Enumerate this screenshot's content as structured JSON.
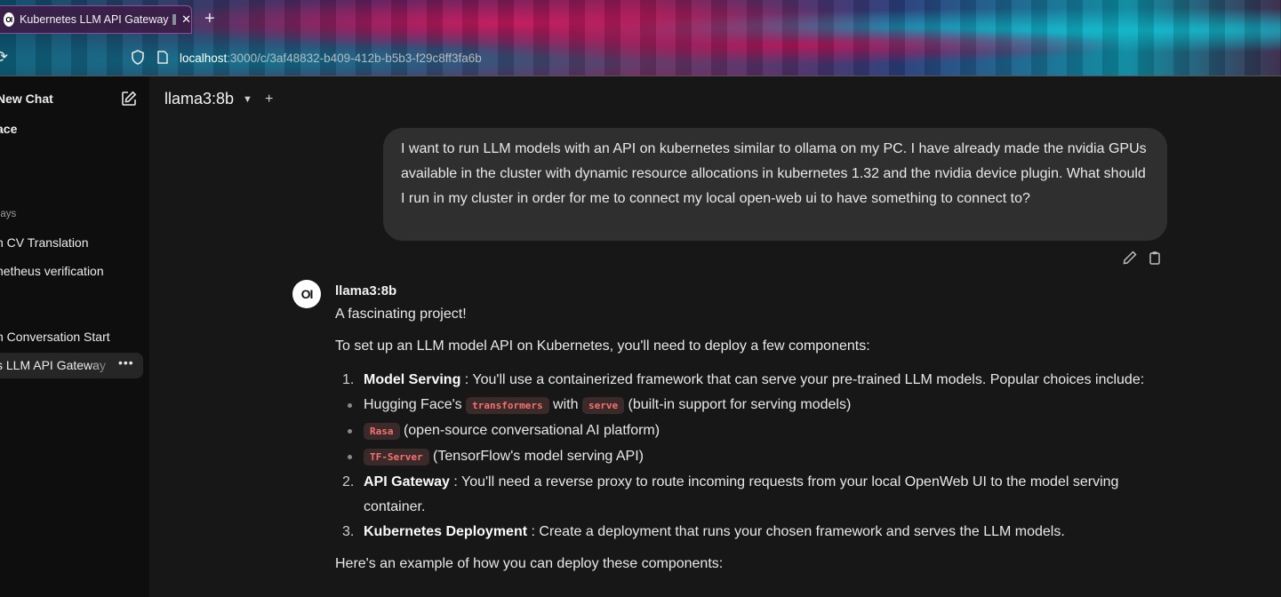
{
  "browser": {
    "tab_title": "Kubernetes LLM API Gateway",
    "tab_close": "✕",
    "new_tab": "+",
    "url_host": "localhost",
    "url_path": ":3000/c/3af48832-b409-412b-b5b3-f29c8ff3fa6b",
    "favicon_text": "OI"
  },
  "sidebar": {
    "new_chat": "New Chat",
    "workspace": "ace",
    "section_label": "days",
    "chats": [
      "h CV Translation",
      "netheus verification",
      "h Conversation Start"
    ],
    "active_chat": "s LLM API Gateway",
    "more": "•••"
  },
  "header": {
    "model": "llama3:8b",
    "chevron": "⌄",
    "add": "+"
  },
  "user_message": "I want to run LLM models with an API on kubernetes similar to ollama on my PC. I have already made the nvidia GPUs available in the cluster with dynamic resource allocations in kubernetes 1.32 and the nvidia device plugin. What should I run in my cluster in order for me to connect my local open-web ui to have something to connect to?",
  "assistant": {
    "avatar": "OI",
    "name": "llama3:8b",
    "intro": "A fascinating project!",
    "lead": "To set up an LLM model API on Kubernetes, you'll need to deploy a few components:",
    "items": [
      {
        "num": "1.",
        "title": "Model Serving",
        "text": " : You'll use a containerized framework that can serve your pre-trained LLM models. Popular choices include:"
      },
      {
        "num": "2.",
        "title": "API Gateway",
        "text": " : You'll need a reverse proxy to route incoming requests from your local OpenWeb UI to the model serving container."
      },
      {
        "num": "3.",
        "title": "Kubernetes Deployment",
        "text": " : Create a deployment that runs your chosen framework and serves the LLM models."
      }
    ],
    "sub1": {
      "pre": "Hugging Face's ",
      "code1": "transformers",
      "mid": " with ",
      "code2": "serve",
      "post": " (built-in support for serving models)"
    },
    "sub2": {
      "code": "Rasa",
      "post": " (open-source conversational AI platform)"
    },
    "sub3": {
      "code": "TF-Server",
      "post": " (TensorFlow's model serving API)"
    },
    "outro": "Here's an example of how you can deploy these components:"
  }
}
